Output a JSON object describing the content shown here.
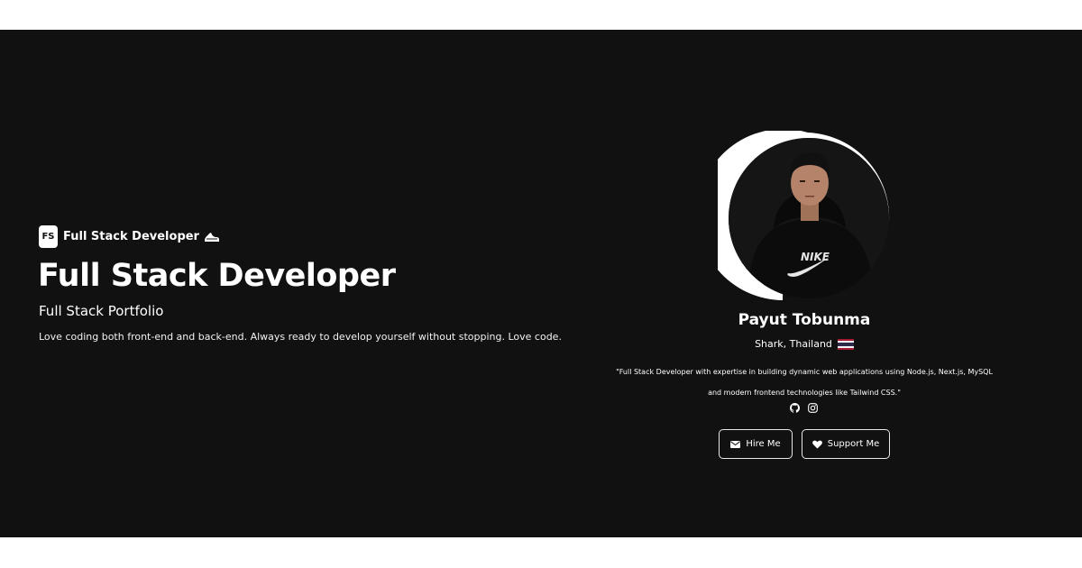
{
  "brand": {
    "logo_text": "FS",
    "label": "Full Stack Developer",
    "icon": "sneaker-icon"
  },
  "hero": {
    "title": "Full Stack Developer",
    "subtitle": "Full Stack Portfolio",
    "description": "Love coding both front-end and back-end. Always ready to develop yourself without stopping. Love code."
  },
  "profile": {
    "name": "Payut Tobunma",
    "location": "Shark, Thailand",
    "flag": "thailand-flag-icon",
    "bio_line1": "\"Full Stack Developer with expertise in building dynamic web applications using Node.js, Next.js, MySQL",
    "bio_line2": "and modern frontend technologies like Tailwind CSS.\"",
    "socials": [
      "github-icon",
      "instagram-icon"
    ]
  },
  "actions": {
    "hire_label": "Hire Me",
    "support_label": "Support Me"
  },
  "colors": {
    "background": "#121112",
    "text": "#ffffff",
    "accent": "#ffffff"
  }
}
